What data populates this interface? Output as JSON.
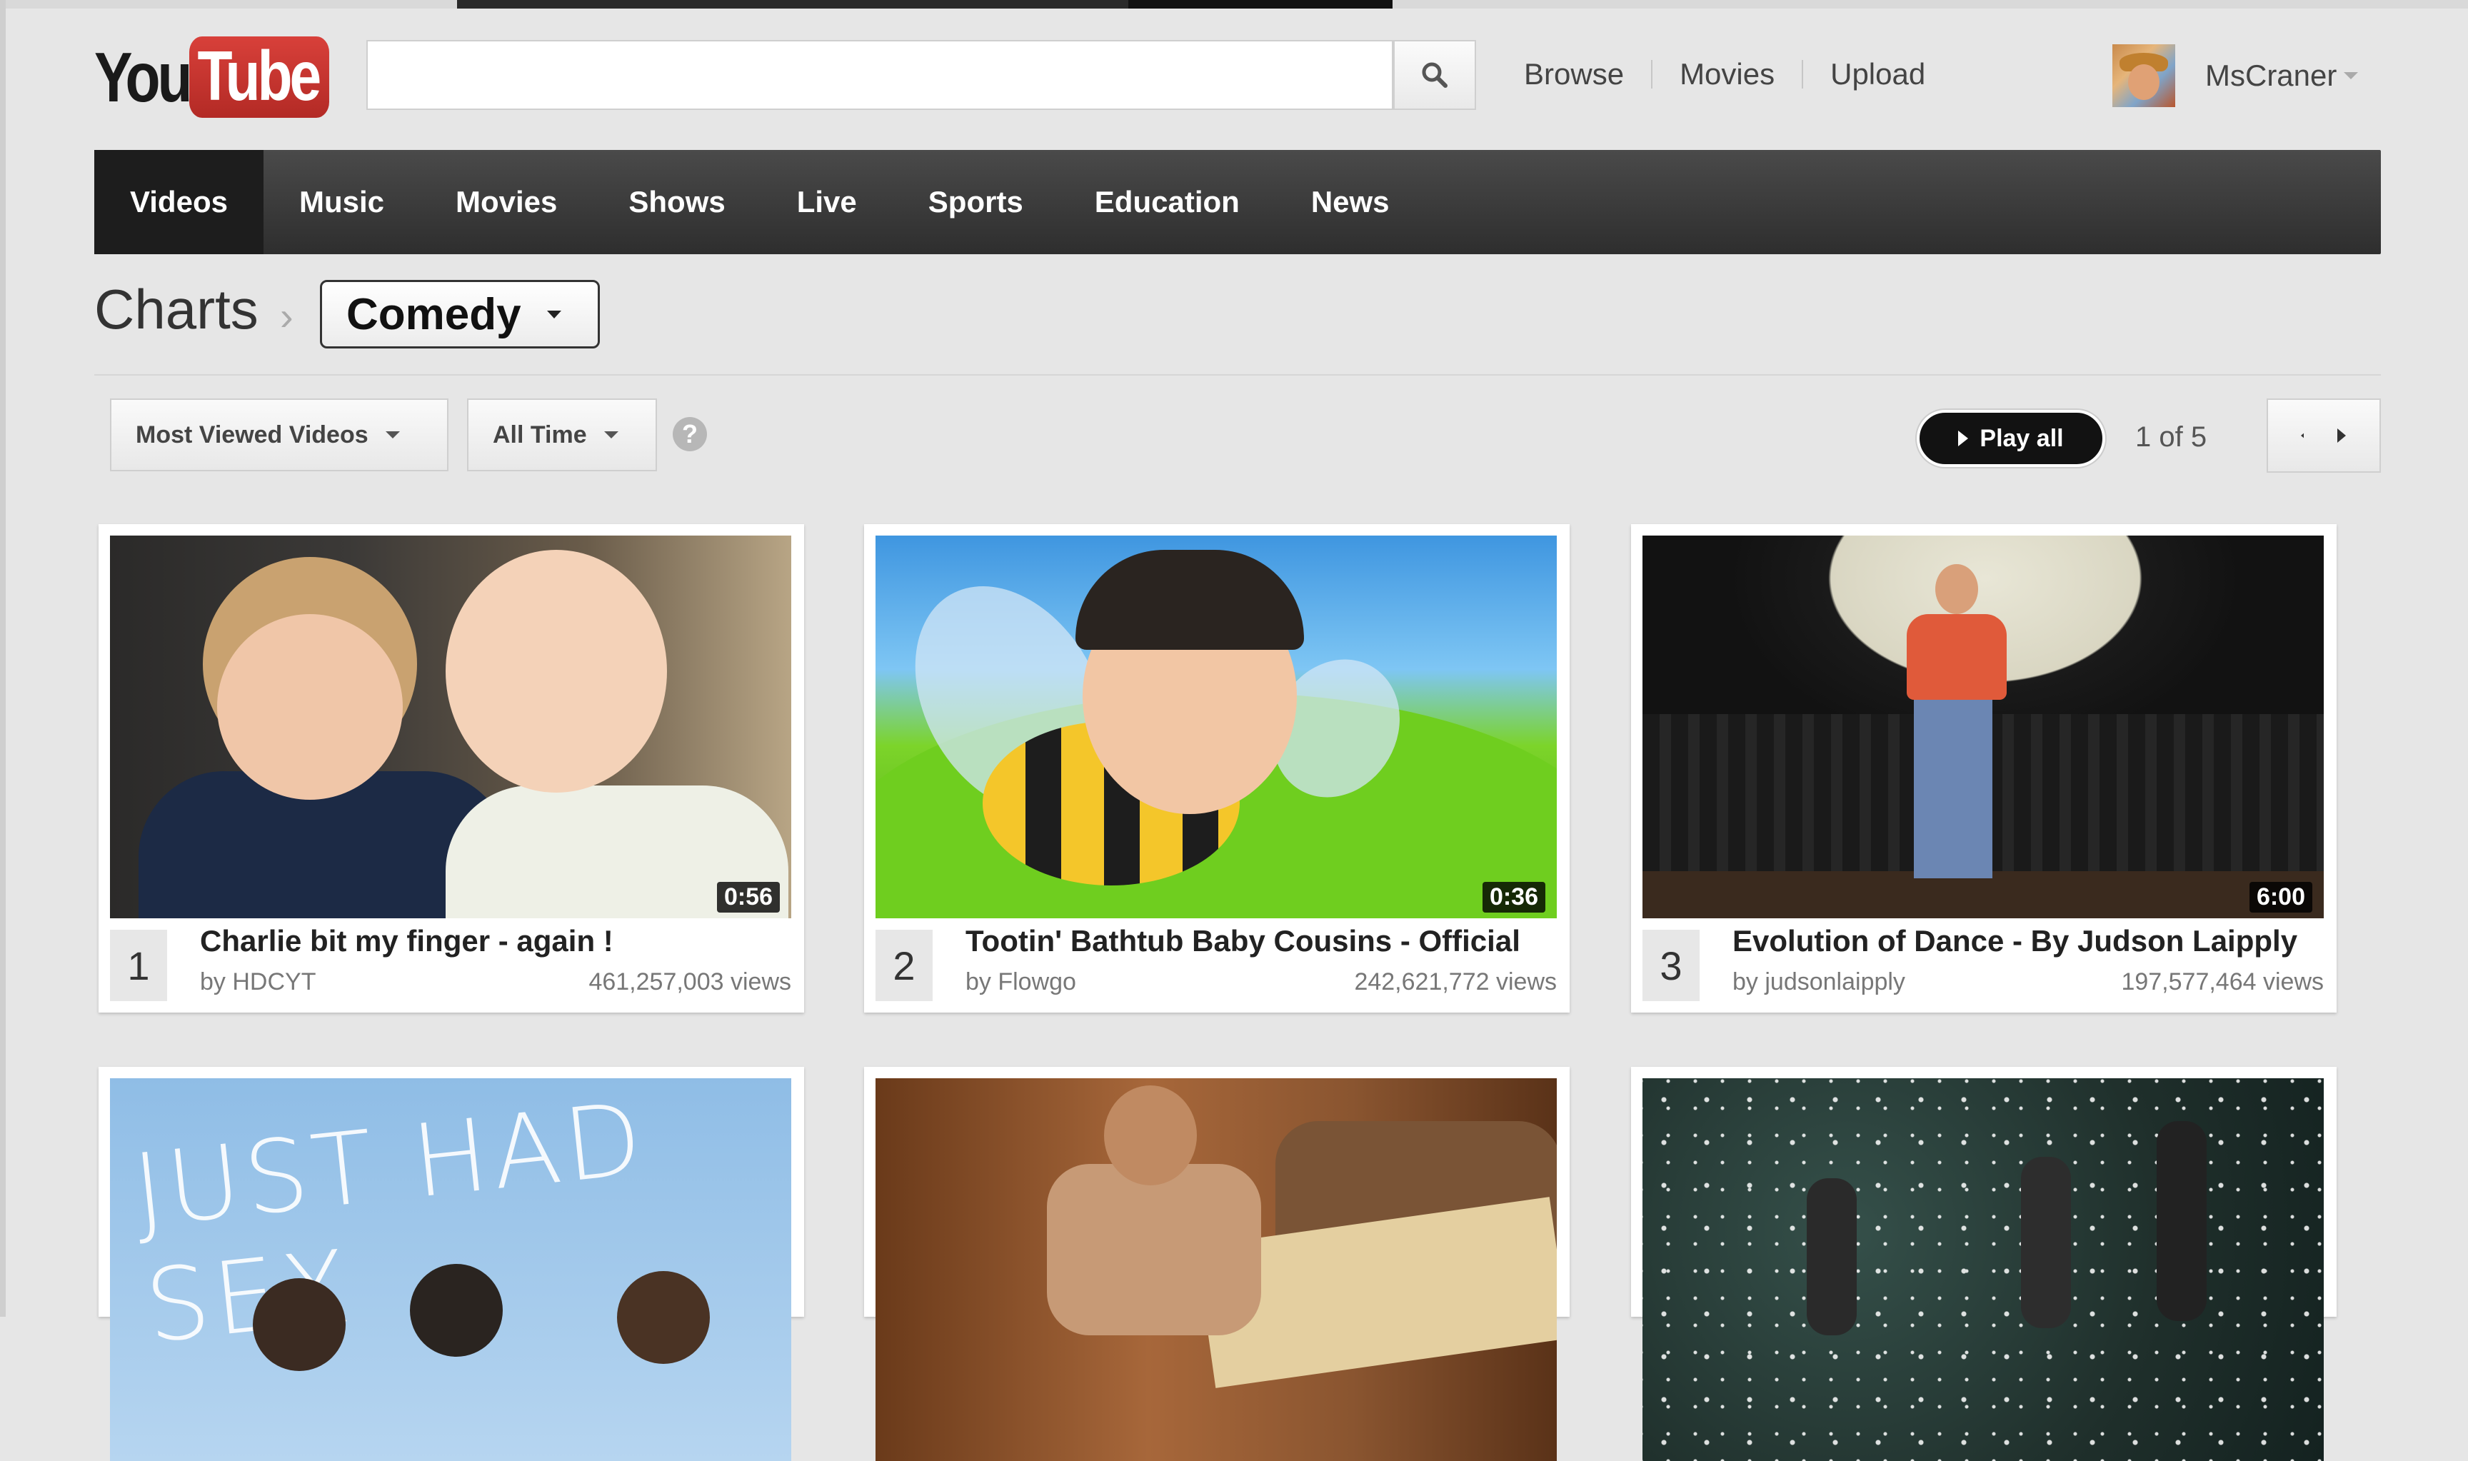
{
  "header": {
    "logo_you": "You",
    "logo_tube": "Tube",
    "search": {
      "value": "",
      "placeholder": ""
    },
    "nav": [
      "Browse",
      "Movies",
      "Upload"
    ],
    "user": {
      "name": "MsCraner"
    }
  },
  "categories": {
    "items": [
      "Videos",
      "Music",
      "Movies",
      "Shows",
      "Live",
      "Sports",
      "Education",
      "News"
    ],
    "active": "Videos"
  },
  "breadcrumb": {
    "root": "Charts",
    "separator": "›",
    "category": "Comedy"
  },
  "filters": {
    "sort": "Most Viewed Videos",
    "period": "All Time",
    "help": "?"
  },
  "player": {
    "play_all": "Play all",
    "page_count": "1 of 5"
  },
  "videos": [
    {
      "rank": "1",
      "title": "Charlie bit my finger - again !",
      "by": "by HDCYT",
      "views": "461,257,003 views",
      "duration": "0:56"
    },
    {
      "rank": "2",
      "title": "Tootin' Bathtub Baby Cousins - Official",
      "by": "by Flowgo",
      "views": "242,621,772 views",
      "duration": "0:36"
    },
    {
      "rank": "3",
      "title": "Evolution of Dance - By Judson Laipply",
      "by": "by judsonlaipply",
      "views": "197,577,464 views",
      "duration": "6:00"
    }
  ],
  "more_thumbnails": {
    "sky_text": "JUST HAD SEX"
  },
  "colors": {
    "accent": "#c4302b",
    "category_bar": "#3a3a3a"
  },
  "icons": [
    "search-icon",
    "caret-down-icon",
    "help-icon",
    "play-icon",
    "prev-icon",
    "next-icon"
  ]
}
